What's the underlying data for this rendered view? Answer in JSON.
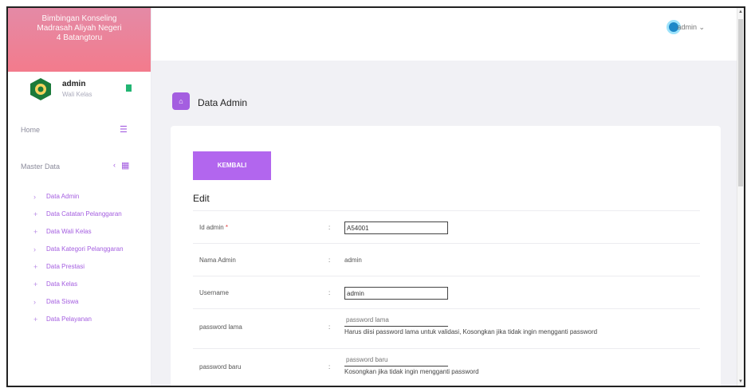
{
  "brand": {
    "line1": "Bimbingan Konseling",
    "line2": "Madrasah Aliyah Negeri",
    "line3": "4 Batangtoru"
  },
  "user": {
    "name": "admin",
    "role": "Wali Kelas"
  },
  "sidebar": {
    "home_label": "Home",
    "master_label": "Master Data",
    "items": [
      {
        "label": "Data Admin"
      },
      {
        "label": "Data Catatan Pelanggaran"
      },
      {
        "label": "Data Wali Kelas"
      },
      {
        "label": "Data Kategori Pelanggaran"
      },
      {
        "label": "Data Prestasi"
      },
      {
        "label": "Data Kelas"
      },
      {
        "label": "Data Siswa"
      },
      {
        "label": "Data Pelayanan"
      }
    ]
  },
  "topbar": {
    "user_label": "admin ⌄"
  },
  "page": {
    "title": "Data Admin",
    "back_button": "KEMBALI",
    "section_label": "Edit"
  },
  "form": {
    "rows": [
      {
        "label": "Id admin",
        "required_mark": "*",
        "colon": ":",
        "value": "A54001"
      },
      {
        "label": "Nama Admin",
        "colon": ":",
        "value": "admin"
      },
      {
        "label": "Username",
        "colon": ":",
        "value": "admin"
      },
      {
        "label": "password lama",
        "colon": ":",
        "placeholder": "password lama",
        "note": "Harus diisi password lama untuk validasi, Kosongkan jika tidak ingin mengganti password"
      },
      {
        "label": "password baru",
        "colon": ":",
        "placeholder": "password baru",
        "note": "Kosongkan jika tidak ingin mengganti password"
      }
    ]
  }
}
